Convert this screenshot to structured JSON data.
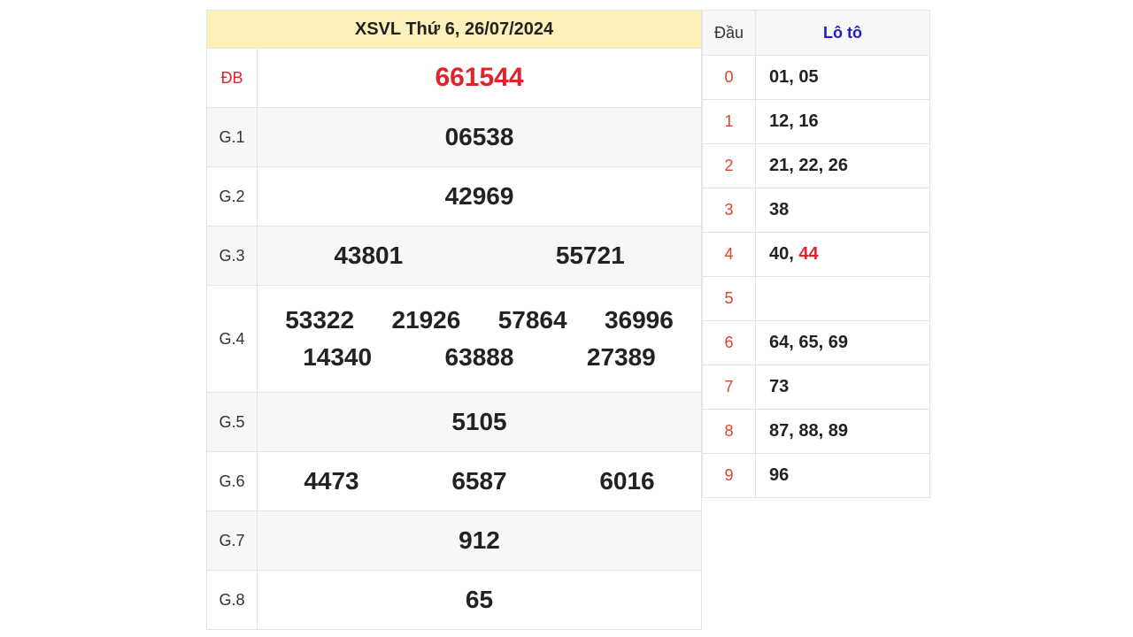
{
  "results": {
    "title": "XSVL Thứ 6, 26/07/2024",
    "prizes": [
      {
        "label": "ĐB",
        "values": [
          "661544"
        ],
        "special": true
      },
      {
        "label": "G.1",
        "values": [
          "06538"
        ]
      },
      {
        "label": "G.2",
        "values": [
          "42969"
        ]
      },
      {
        "label": "G.3",
        "values": [
          "43801",
          "55721"
        ]
      },
      {
        "label": "G.4",
        "values": [
          "53322",
          "21926",
          "57864",
          "36996",
          "14340",
          "63888",
          "27389"
        ]
      },
      {
        "label": "G.5",
        "values": [
          "5105"
        ]
      },
      {
        "label": "G.6",
        "values": [
          "4473",
          "6587",
          "6016"
        ]
      },
      {
        "label": "G.7",
        "values": [
          "912"
        ]
      },
      {
        "label": "G.8",
        "values": [
          "65"
        ]
      }
    ]
  },
  "loto": {
    "header_dau": "Đầu",
    "header_loto": "Lô tô",
    "rows": [
      {
        "dau": "0",
        "values": "01, 05"
      },
      {
        "dau": "1",
        "values": "12, 16"
      },
      {
        "dau": "2",
        "values": "21, 22, 26"
      },
      {
        "dau": "3",
        "values": "38"
      },
      {
        "dau": "4",
        "values": "40, ",
        "highlight": "44"
      },
      {
        "dau": "5",
        "values": ""
      },
      {
        "dau": "6",
        "values": "64, 65, 69"
      },
      {
        "dau": "7",
        "values": "73"
      },
      {
        "dau": "8",
        "values": "87, 88, 89"
      },
      {
        "dau": "9",
        "values": "96"
      }
    ]
  },
  "colors": {
    "header_bg": "#fdf0b8",
    "special": "#e0242a",
    "loto_header": "#1a1ac8",
    "dau": "#e0412a"
  }
}
